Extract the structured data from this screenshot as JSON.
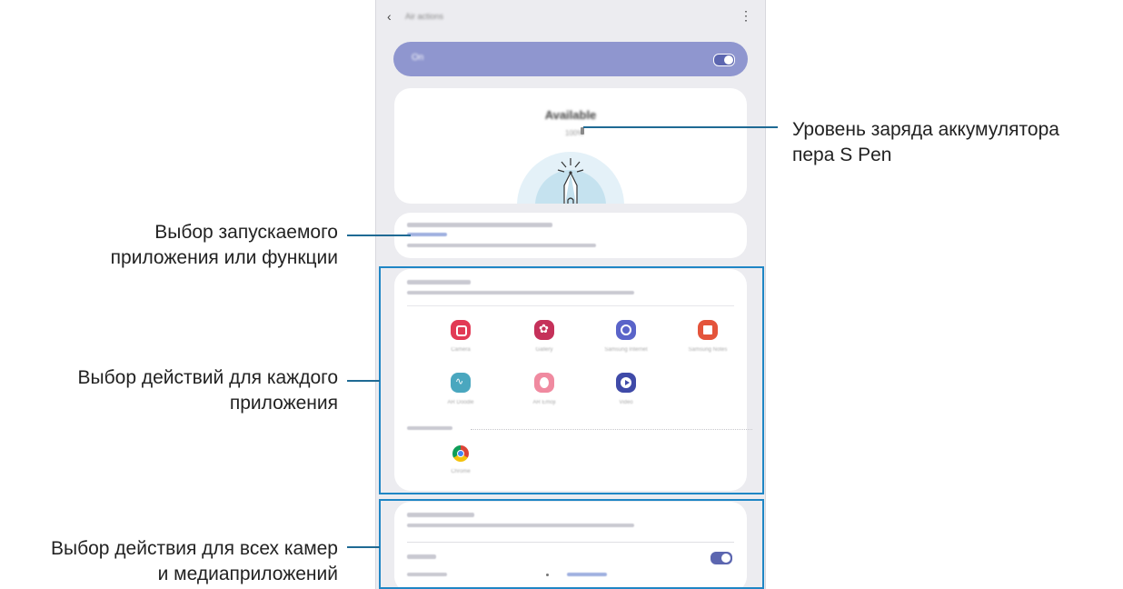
{
  "annotations": {
    "battery_level": [
      "Уровень заряда аккумулятора",
      "пера S Pen"
    ],
    "launch_app": [
      "Выбор запускаемого",
      "приложения или функции"
    ],
    "app_actions": [
      "Выбор действий для каждого",
      "приложения"
    ],
    "general_actions": [
      "Выбор действия для всех камер",
      "и медиаприложений"
    ]
  },
  "colors": {
    "callout_frame": "#1f86c5",
    "toggle_bar": "#8f96cf",
    "accent": "#5c66b0"
  },
  "icons": {
    "back": "‹",
    "more": "⋮"
  }
}
